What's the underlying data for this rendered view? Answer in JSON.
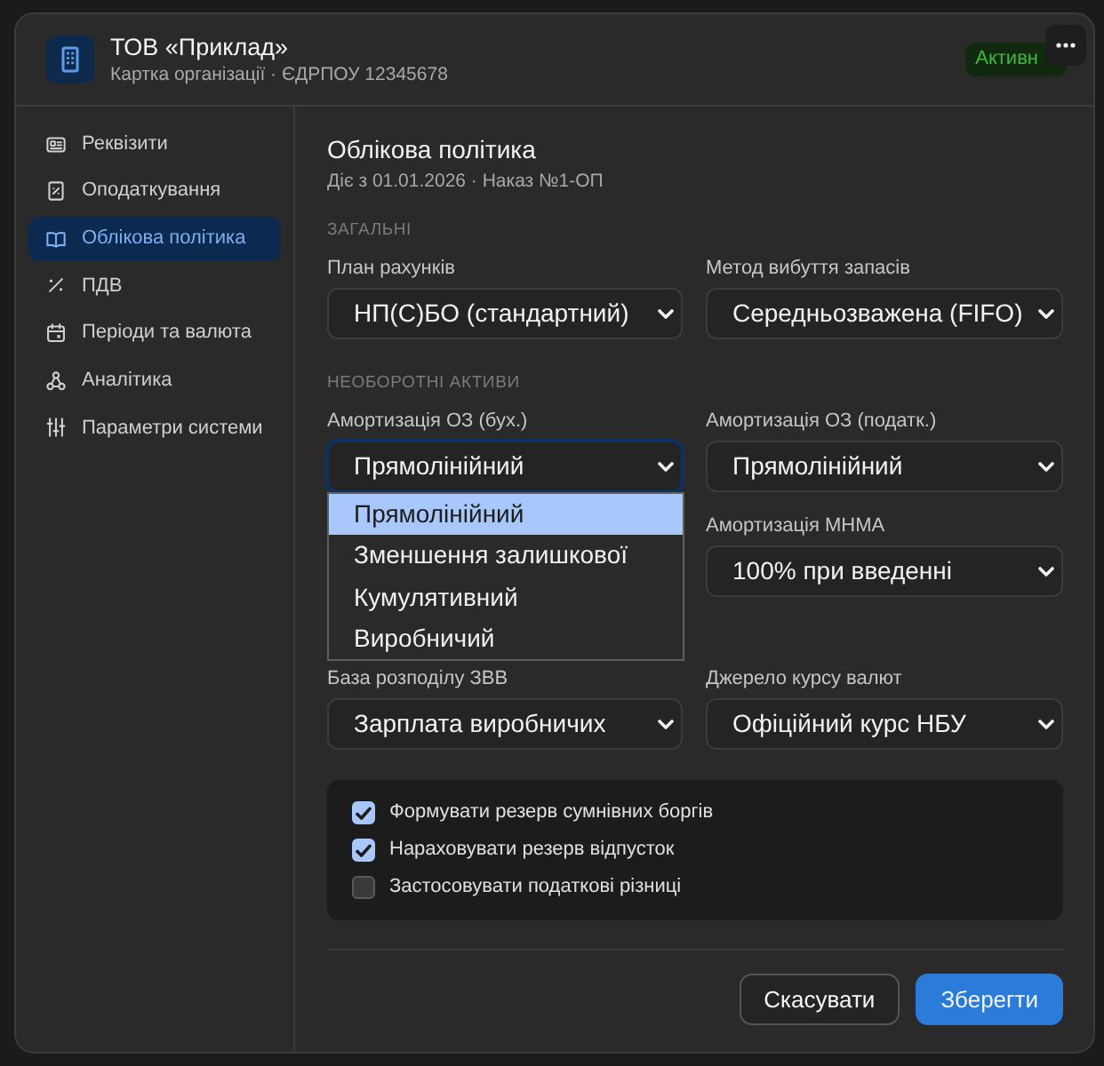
{
  "header": {
    "title": "ТОВ «Приклад»",
    "subtitle": "Картка організації · ЄДРПОУ 12345678",
    "badge": "Активн"
  },
  "sidebar": {
    "items": [
      {
        "label": "Реквізити",
        "selected": false
      },
      {
        "label": "Оподаткування",
        "selected": false
      },
      {
        "label": "Облікова політика",
        "selected": true
      },
      {
        "label": "ПДВ",
        "selected": false
      },
      {
        "label": "Періоди та валюта",
        "selected": false
      },
      {
        "label": "Аналітика",
        "selected": false
      },
      {
        "label": "Параметри системи",
        "selected": false
      }
    ]
  },
  "content": {
    "title": "Облікова політика",
    "subtitle": "Діє з 01.01.2026 · Наказ №1-ОП",
    "sections": [
      {
        "heading": "ЗАГАЛЬНІ",
        "rows": [
          {
            "left": {
              "label": "План рахунків",
              "value": "НП(С)БО (стандартний)",
              "open": false
            },
            "right": {
              "label": "Метод вибуття запасів",
              "value": "Середньозважена (FIFO)",
              "open": false
            }
          }
        ]
      },
      {
        "heading": "НЕОБОРОТНІ АКТИВИ",
        "rows": [
          {
            "left": {
              "label": "Амортизація ОЗ (бух.)",
              "value": "Прямолінійний",
              "open": true,
              "options": [
                {
                  "label": "Прямолінійний",
                  "selected": true
                },
                {
                  "label": "Зменшення залишкової",
                  "selected": false
                },
                {
                  "label": "Кумулятивний",
                  "selected": false
                },
                {
                  "label": "Виробничий",
                  "selected": false
                }
              ]
            },
            "right": {
              "label": "Амортизація ОЗ (податк.)",
              "value": "Прямолінійний",
              "open": false
            }
          },
          {
            "right": {
              "label": "Амортизація МНМА",
              "value": "100% при введенні",
              "open": false
            }
          }
        ]
      },
      {
        "rows": [
          {
            "left": {
              "label": "База розподілу ЗВВ",
              "value": "Зарплата виробничих",
              "open": false
            },
            "right": {
              "label": "Джерело курсу валют",
              "value": "Офіційний курс НБУ",
              "open": false
            }
          }
        ]
      }
    ],
    "checkboxes": [
      {
        "label": "Формувати резерв сумнівних боргів",
        "checked": true
      },
      {
        "label": "Нараховувати резерв відпусток",
        "checked": true
      },
      {
        "label": "Застосовувати податкові різниці",
        "checked": false
      }
    ],
    "buttons": [
      {
        "label": "Скасувати",
        "kind": "secondary"
      },
      {
        "label": "Зберегти",
        "kind": "primary"
      }
    ]
  }
}
